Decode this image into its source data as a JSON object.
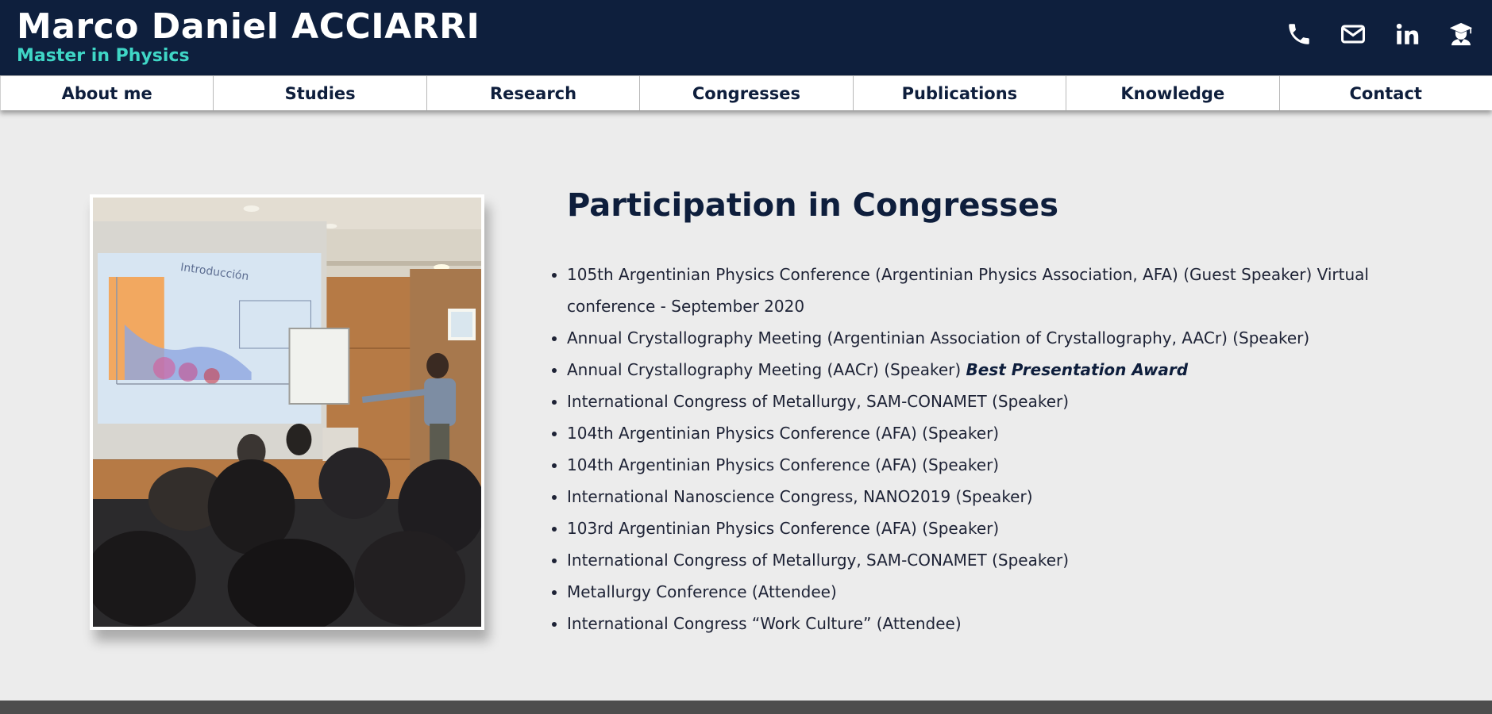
{
  "header": {
    "name": "Marco Daniel ACCIARRI",
    "subtitle": "Master in Physics",
    "icons": [
      "phone-icon",
      "mail-icon",
      "linkedin-icon",
      "graduate-icon"
    ]
  },
  "nav": {
    "items": [
      {
        "label": "About me"
      },
      {
        "label": "Studies"
      },
      {
        "label": "Research"
      },
      {
        "label": "Congresses"
      },
      {
        "label": "Publications"
      },
      {
        "label": "Knowledge"
      },
      {
        "label": "Contact"
      }
    ]
  },
  "main": {
    "title": "Participation in Congresses",
    "photo": {
      "slide_title": "Introducción"
    },
    "congresses": [
      {
        "text": "105th Argentinian Physics Conference (Argentinian Physics Association, AFA) (Guest Speaker) Virtual conference - September 2020"
      },
      {
        "text": "Annual Crystallography Meeting (Argentinian Association of Crystallography, AACr) (Speaker)"
      },
      {
        "text": "Annual Crystallography Meeting (AACr) (Speaker) ",
        "award": "Best Presentation Award"
      },
      {
        "text": "International Congress of Metallurgy, SAM-CONAMET (Speaker)"
      },
      {
        "text": "104th Argentinian Physics Conference (AFA) (Speaker)"
      },
      {
        "text": "104th Argentinian Physics Conference (AFA) (Speaker)"
      },
      {
        "text": "International Nanoscience Congress, NANO2019 (Speaker)"
      },
      {
        "text": "103rd Argentinian Physics Conference (AFA) (Speaker)"
      },
      {
        "text": "International Congress of Metallurgy, SAM-CONAMET (Speaker)"
      },
      {
        "text": "Metallurgy Conference (Attendee)"
      },
      {
        "text": "International Congress “Work Culture” (Attendee)"
      }
    ]
  },
  "colors": {
    "header_bg": "#0e1f3d",
    "subtitle": "#3fd6c6",
    "page_bg": "#ececec",
    "text": "#0e1e3c"
  }
}
